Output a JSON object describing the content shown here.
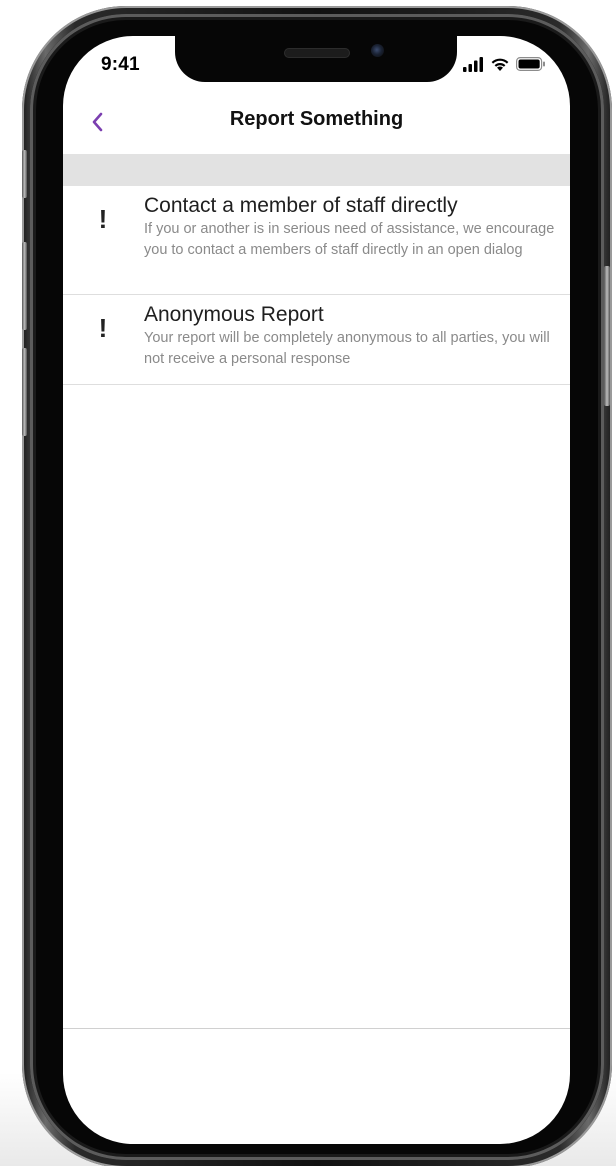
{
  "status_bar": {
    "time": "9:41",
    "icons": [
      "signal-icon",
      "wifi-icon",
      "battery-icon"
    ]
  },
  "nav": {
    "back_icon": "chevron-left-icon",
    "title": "Report Something",
    "accent_color": "#7b3fb0"
  },
  "options": [
    {
      "icon": "exclamation-icon",
      "icon_glyph": "!",
      "title": "Contact a member of staff directly",
      "description": "If you or another is in serious need of assistance, we encourage you to contact a members of staff directly in an open dialog"
    },
    {
      "icon": "exclamation-icon",
      "icon_glyph": "!",
      "title": "Anonymous Report",
      "description": "Your report will be completely anonymous to all parties, you will not receive a personal response"
    }
  ]
}
